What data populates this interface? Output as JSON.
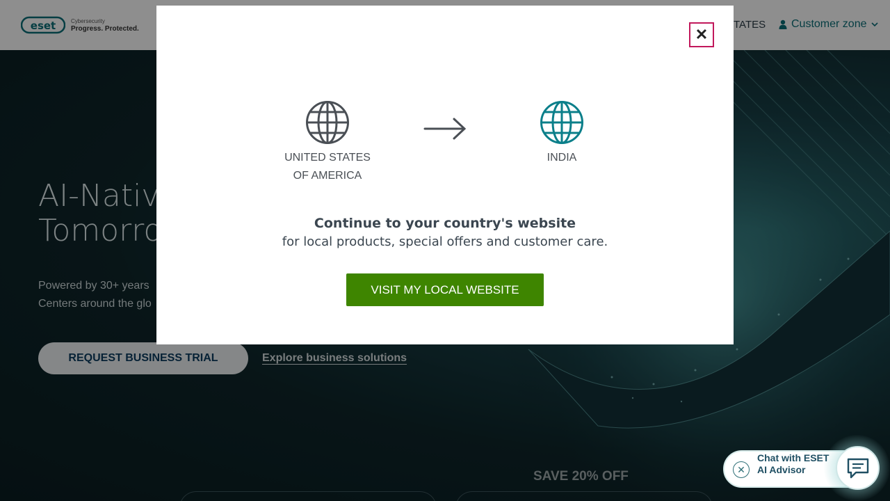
{
  "header": {
    "logo_small": "Cybersecurity",
    "logo_tag": "Progress. Protected.",
    "country_label": "TATES",
    "customer_zone": "Customer zone"
  },
  "hero": {
    "title_line1": "AI-Nativ",
    "title_line2": "Tomorro",
    "sub_line1": "Powered by 30+ years",
    "sub_line2": "Centers around the glo",
    "trial_button": "REQUEST BUSINESS TRIAL",
    "explore_link": "Explore business solutions",
    "save_off": "SAVE 20% OFF"
  },
  "modal": {
    "close_symbol": "✕",
    "from_line1": "UNITED STATES",
    "from_line2": "OF AMERICA",
    "to_country": "INDIA",
    "heading": "Continue to your country's website",
    "subtext": "for local products, special offers and customer care.",
    "visit_button": "VISIT MY LOCAL WEBSITE"
  },
  "chat": {
    "close_symbol": "✕",
    "label": "Chat with ESET AI Advisor"
  },
  "colors": {
    "visit_button_bg": "#3e8500",
    "close_border": "#c2185b",
    "globe_to": "#0b7f8a",
    "globe_from": "#4a4f55",
    "brand_teal": "#0b6b74"
  }
}
